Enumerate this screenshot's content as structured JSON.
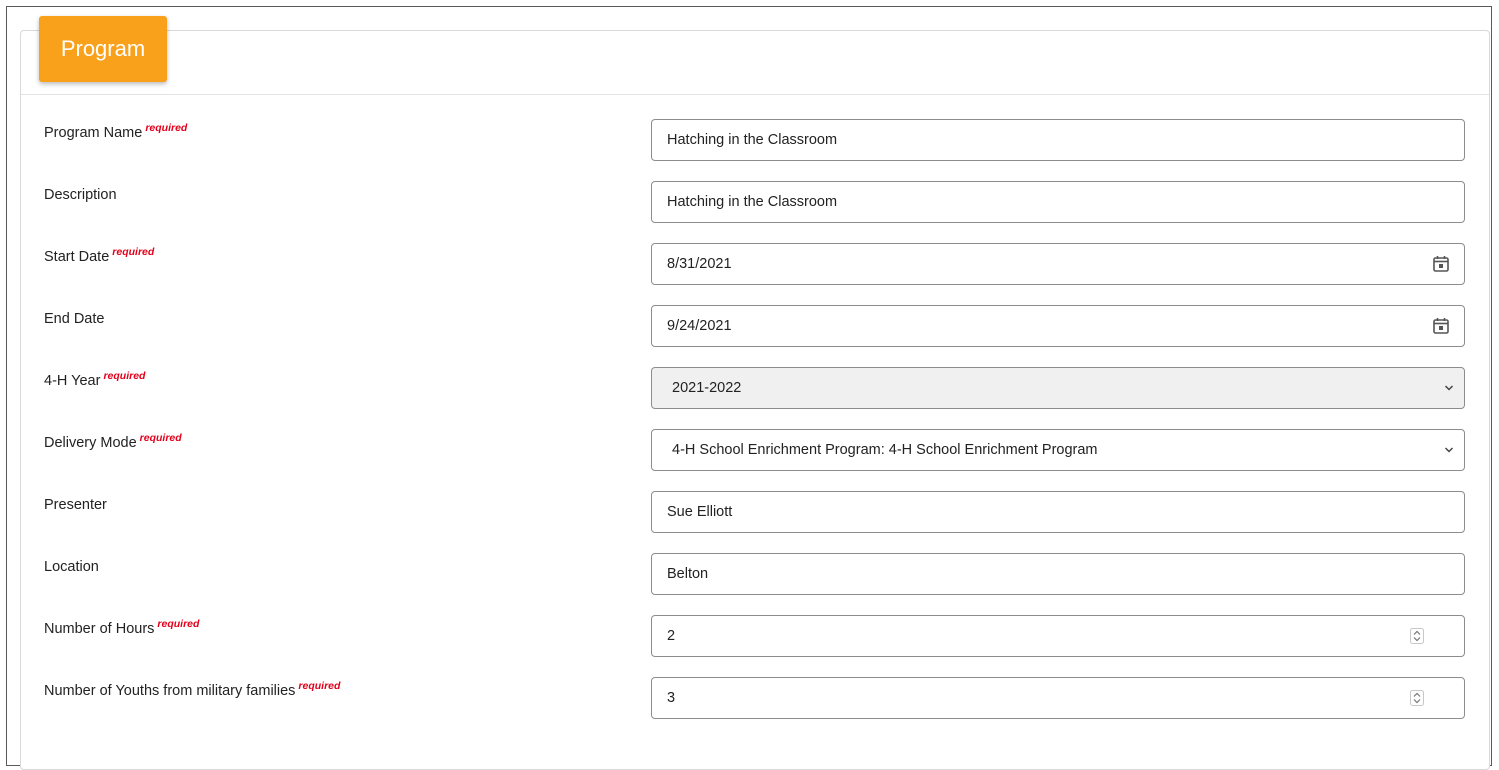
{
  "card": {
    "title": "Program"
  },
  "colors": {
    "accent": "#f9a11b",
    "required": "#e3001b",
    "disabled_bg": "#f0f0f0"
  },
  "fields": [
    {
      "label": "Program Name",
      "required": "required",
      "value": "Hatching in the Classroom",
      "type": "text"
    },
    {
      "label": "Description",
      "required": "",
      "value": "Hatching in the Classroom",
      "type": "text"
    },
    {
      "label": "Start Date",
      "required": "required",
      "value": "8/31/2021",
      "type": "date",
      "icon": "calendar-icon"
    },
    {
      "label": "End Date",
      "required": "",
      "value": "9/24/2021",
      "type": "date",
      "icon": "calendar-icon"
    },
    {
      "label": "4-H Year",
      "required": "required",
      "value": "2021-2022",
      "type": "select",
      "icon": "chevron-down-icon"
    },
    {
      "label": "Delivery Mode",
      "required": "required",
      "value": "4-H School Enrichment Program: 4-H School Enrichment Program",
      "type": "select",
      "icon": "chevron-down-icon"
    },
    {
      "label": "Presenter",
      "required": "",
      "value": "Sue Elliott",
      "type": "text"
    },
    {
      "label": "Location",
      "required": "",
      "value": "Belton",
      "type": "text"
    },
    {
      "label": "Number of Hours",
      "required": "required",
      "value": "2",
      "type": "number",
      "icon": "spinner-icon"
    },
    {
      "label": "Number of Youths from military families",
      "required": "required",
      "value": "3",
      "type": "number",
      "icon": "spinner-icon"
    }
  ]
}
